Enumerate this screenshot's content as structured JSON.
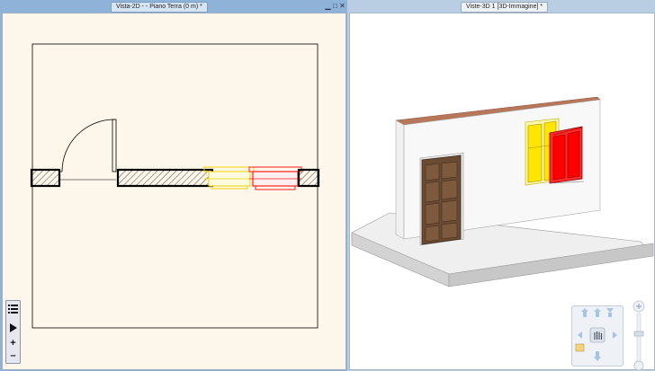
{
  "windows": {
    "view2d": {
      "title": "Vista-2D -   - Piano Terra (0 m) *",
      "controls": {
        "restore": "□",
        "close": "✕"
      }
    },
    "view3d": {
      "title": "Viste-3D 1 [3D-Immagine] *"
    }
  },
  "toolbar2d": {
    "icons": [
      "list-icon",
      "play-icon",
      "zoom-in-icon",
      "zoom-out-icon"
    ],
    "zoom_in": "+",
    "zoom_out": "–"
  },
  "colors": {
    "plan_background": "#fdf6ea",
    "wall_hatch": "#000000",
    "window_yellow": "#ffe600",
    "window_red": "#ff1a1a",
    "door_wood": "#6a4a32",
    "wall_top": "#b9775a"
  }
}
